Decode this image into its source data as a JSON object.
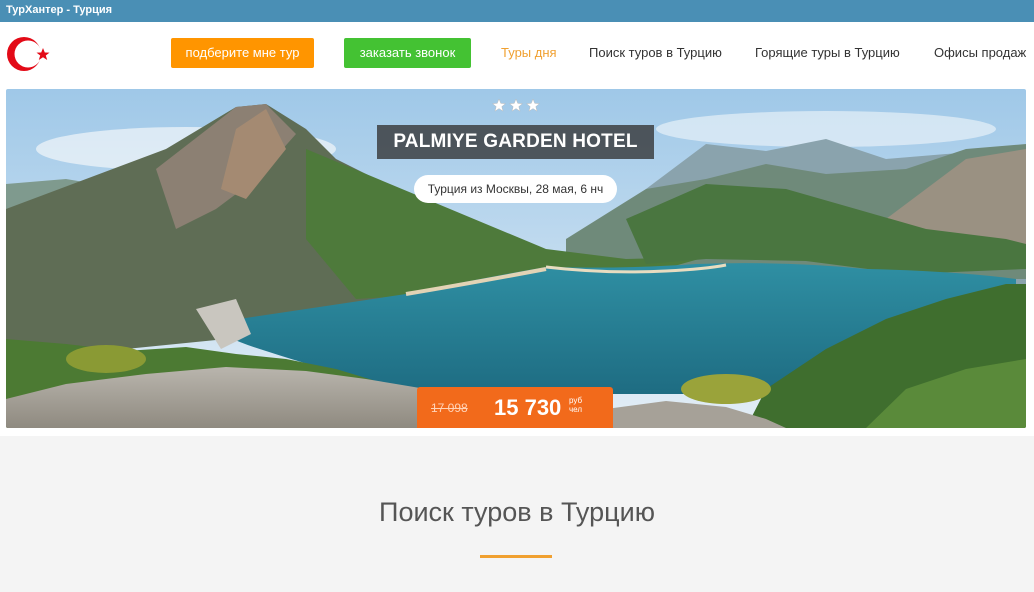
{
  "window": {
    "title": "ТурХантер - Турция"
  },
  "header": {
    "logo_icon": "turkey-flag-icon",
    "buttons": [
      {
        "label": "подберите мне тур",
        "color": "#ff9500"
      },
      {
        "label": "заказать звонок",
        "color": "#44c233"
      }
    ],
    "nav": [
      {
        "label": "Туры дня",
        "active": true
      },
      {
        "label": "Поиск туров в Турцию",
        "active": false
      },
      {
        "label": "Горящие туры в Турцию",
        "active": false
      },
      {
        "label": "Офисы продаж",
        "active": false
      }
    ]
  },
  "hero": {
    "stars": 3,
    "hotel_name": "PALMIYE GARDEN HOTEL",
    "subtitle": "Турция из Москвы, 28 мая, 6 нч",
    "old_price": "17 098",
    "price": "15 730",
    "price_unit_line1": "руб",
    "price_unit_line2": "чел",
    "accent_color": "#f26a1b"
  },
  "section": {
    "title": "Поиск туров в Турцию"
  }
}
